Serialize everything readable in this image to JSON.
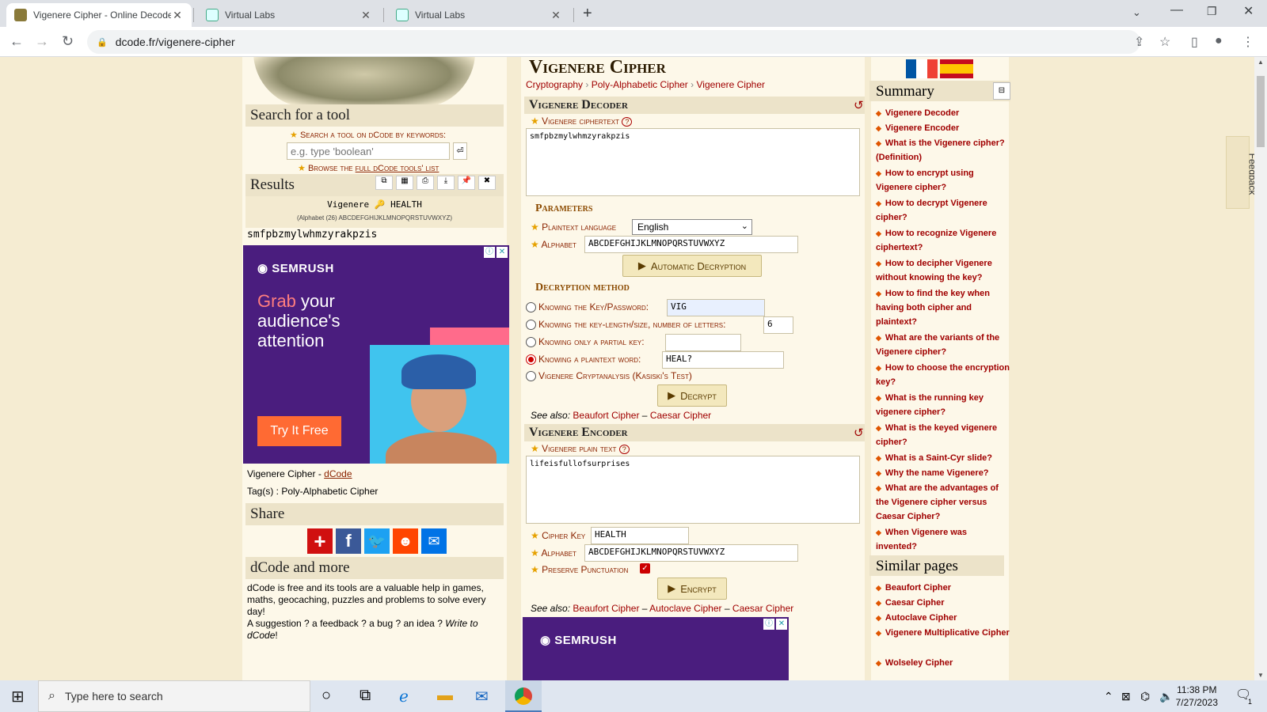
{
  "browser": {
    "tabs": [
      {
        "title": "Vigenere Cipher - Online Decode",
        "active": true
      },
      {
        "title": "Virtual Labs",
        "active": false
      },
      {
        "title": "Virtual Labs",
        "active": false
      }
    ],
    "url": "dcode.fr/vigenere-cipher"
  },
  "left": {
    "search_title": "Search for a tool",
    "search_label": "Search a tool on dCode by keywords:",
    "search_placeholder": "e.g. type 'boolean'",
    "browse_prefix": "Browse the",
    "browse_link": "full dCode tools' list",
    "results_title": "Results",
    "result_line": "Vigenere 🔑 HEALTH",
    "result_alphabet": "(Alphabet (26) ABCDEFGHIJKLMNOPQRSTUVWXYZ)",
    "result_text": "smfpbzmylwhmzyrakpzis",
    "ad_brand": "SEMRUSH",
    "ad_grab": "Grab",
    "ad_your": " your",
    "ad_line2": "audience's",
    "ad_line3": "attention",
    "ad_cta": "Try It Free",
    "credit_prefix": "Vigenere Cipher - ",
    "credit_link": "dCode",
    "tags": "Tag(s) : Poly-Alphabetic Cipher",
    "share_title": "Share",
    "more_title": "dCode and more",
    "more_text": "dCode is free and its tools are a valuable help in games, maths, geocaching, puzzles and problems to solve every day!",
    "more_text2": "A suggestion ? a feedback ? a bug ? an idea ? ",
    "more_write": "Write to dCode",
    "more_end": "!"
  },
  "center": {
    "page_title": "Vigenere Cipher",
    "breadcrumb": [
      "Cryptography",
      "Poly-Alphabetic Cipher",
      "Vigenere Cipher"
    ],
    "decoder_title": "Vigenere Decoder",
    "ciphertext_label": "Vigenere ciphertext",
    "ciphertext_value": "smfpbzmylwhmzyrakpzis",
    "params_title": "Parameters",
    "plaintext_lang_label": "Plaintext language",
    "plaintext_lang_value": "English",
    "alphabet_label": "Alphabet",
    "alphabet_value": "ABCDEFGHIJKLMNOPQRSTUVWXYZ",
    "auto_decrypt": "Automatic Decryption",
    "method_title": "Decryption method",
    "methods": [
      {
        "label": "Knowing the Key/Password:",
        "value": "VIG",
        "checked": false
      },
      {
        "label": "Knowing the key-length/size, number of letters:",
        "value": "6",
        "checked": false
      },
      {
        "label": "Knowing only a partial key:",
        "value": "",
        "checked": false
      },
      {
        "label": "Knowing a plaintext word:",
        "value": "HEAL?",
        "checked": true
      },
      {
        "label": "Vigenere Cryptanalysis (Kasiski's Test)",
        "checked": false
      }
    ],
    "decrypt_btn": "Decrypt",
    "see_also": "See also:",
    "dec_see_also": [
      "Beaufort Cipher",
      "Caesar Cipher"
    ],
    "encoder_title": "Vigenere Encoder",
    "plain_label": "Vigenere plain text",
    "plain_value": "lifeisfullofsurprises",
    "key_label": "Cipher Key",
    "key_value": "HEALTH",
    "enc_alphabet_label": "Alphabet",
    "enc_alphabet_value": "ABCDEFGHIJKLMNOPQRSTUVWXYZ",
    "preserve_label": "Preserve Punctuation",
    "encrypt_btn": "Encrypt",
    "enc_see_also": [
      "Beaufort Cipher",
      "Autoclave Cipher",
      "Caesar Cipher"
    ],
    "dash": "–",
    "ad2_brand": "SEMRUSH"
  },
  "right": {
    "summary_title": "Summary",
    "summary": [
      "Vigenere Decoder",
      "Vigenere Encoder",
      "What is the Vigenere cipher? (Definition)",
      "How to encrypt using Vigenere cipher?",
      "How to decrypt Vigenere cipher?",
      "How to recognize Vigenere ciphertext?",
      "How to decipher Vigenere without knowing the key?",
      "How to find the key when having both cipher and plaintext?",
      "What are the variants of the Vigenere cipher?",
      "How to choose the encryption key?",
      "What is the running key vigenere cipher?",
      "What is the keyed vigenere cipher?",
      "What is a Saint-Cyr slide?",
      "Why the name Vigenere?",
      "What are the advantages of the Vigenere cipher versus Caesar Cipher?",
      "When Vigenere was invented?"
    ],
    "similar_title": "Similar pages",
    "similar": [
      "Beaufort Cipher",
      "Caesar Cipher",
      "Autoclave Cipher",
      "Vigenere Multiplicative Cipher",
      "Wolseley Cipher"
    ],
    "feedback": "Feedback"
  },
  "taskbar": {
    "search_placeholder": "Type here to search",
    "time": "11:38 PM",
    "date": "7/27/2023",
    "notif": "1"
  }
}
